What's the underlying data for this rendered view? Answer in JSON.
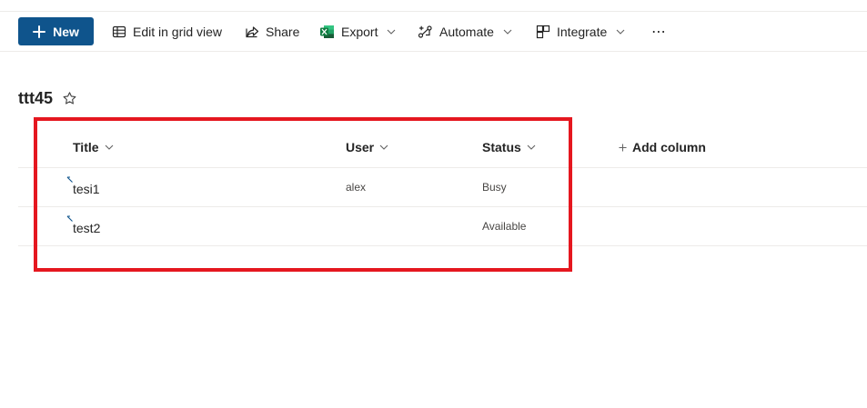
{
  "toolbar": {
    "new_label": "New",
    "edit_grid_label": "Edit in grid view",
    "share_label": "Share",
    "export_label": "Export",
    "automate_label": "Automate",
    "integrate_label": "Integrate",
    "more_label": "⋯"
  },
  "list": {
    "title": "ttt45",
    "columns": {
      "title": "Title",
      "user": "User",
      "status": "Status",
      "add_column": "Add column"
    },
    "rows": [
      {
        "title": "tesi1",
        "user": "alex",
        "status": "Busy"
      },
      {
        "title": "test2",
        "user": "",
        "status": "Available"
      }
    ]
  },
  "colors": {
    "brand": "#0f548c",
    "highlight": "#e5171f",
    "excel_green": "#107c41"
  },
  "icons": [
    "plus-icon",
    "grid-icon",
    "share-icon",
    "excel-icon",
    "automate-icon",
    "integrate-icon",
    "more-icon",
    "star-icon",
    "chevron-down-icon",
    "new-item-icon"
  ]
}
